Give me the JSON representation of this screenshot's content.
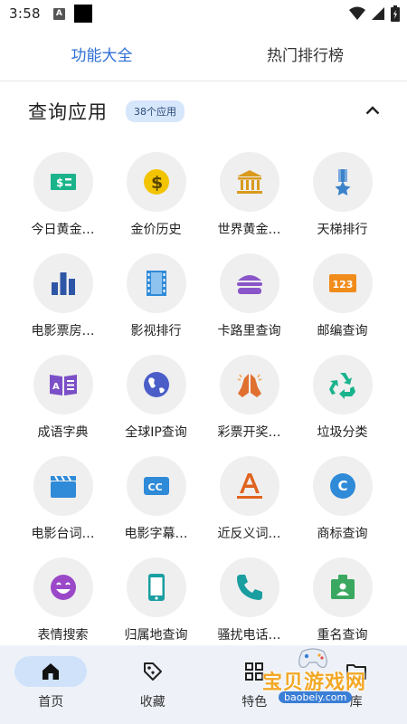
{
  "status_bar": {
    "time": "3:58",
    "a_badge": "A"
  },
  "tabs": [
    {
      "label": "功能大全",
      "active": true
    },
    {
      "label": "热门排行榜",
      "active": false
    }
  ],
  "section": {
    "title": "查询应用",
    "badge": "38个应用"
  },
  "apps": [
    {
      "label": "今日黄金…",
      "icon": "money-icon",
      "color": "#1bb38a"
    },
    {
      "label": "金价历史",
      "icon": "dollar-coin-icon",
      "color": "#f2c400"
    },
    {
      "label": "世界黄金…",
      "icon": "bank-icon",
      "color": "#d99a1e"
    },
    {
      "label": "天梯排行",
      "icon": "medal-icon",
      "color": "#3b82c9"
    },
    {
      "label": "电影票房…",
      "icon": "bar-chart-icon",
      "color": "#2e56a6"
    },
    {
      "label": "影视排行",
      "icon": "film-icon",
      "color": "#2f8ad8"
    },
    {
      "label": "卡路里查询",
      "icon": "burger-icon",
      "color": "#8a55c8"
    },
    {
      "label": "邮编查询",
      "icon": "numbers-icon",
      "color": "#f08c1c"
    },
    {
      "label": "成语字典",
      "icon": "dictionary-icon",
      "color": "#7b4fc7"
    },
    {
      "label": "全球IP查询",
      "icon": "globe-icon",
      "color": "#4b5ec8"
    },
    {
      "label": "彩票开奖…",
      "icon": "praying-hands-icon",
      "color": "#e07030"
    },
    {
      "label": "垃圾分类",
      "icon": "recycle-icon",
      "color": "#19b38c"
    },
    {
      "label": "电影台词…",
      "icon": "clapperboard-icon",
      "color": "#2f8ad8"
    },
    {
      "label": "电影字幕…",
      "icon": "closed-caption-icon",
      "color": "#2f8ad8"
    },
    {
      "label": "近反义词…",
      "icon": "letter-a-icon",
      "color": "#e0641e"
    },
    {
      "label": "商标查询",
      "icon": "copyright-icon",
      "color": "#2f8ad8"
    },
    {
      "label": "表情搜索",
      "icon": "smiley-icon",
      "color": "#9a48c8"
    },
    {
      "label": "归属地查询",
      "icon": "phone-device-icon",
      "color": "#1a9ea0"
    },
    {
      "label": "骚扰电话…",
      "icon": "phone-handset-icon",
      "color": "#1a9ea0"
    },
    {
      "label": "重名查询",
      "icon": "id-badge-icon",
      "color": "#3aa860"
    }
  ],
  "bottom_nav": [
    {
      "label": "首页",
      "icon": "home-icon",
      "active": true
    },
    {
      "label": "收藏",
      "icon": "tag-icon",
      "active": false
    },
    {
      "label": "特色",
      "icon": "grid-icon",
      "active": false
    },
    {
      "label": "库",
      "icon": "folder-icon",
      "active": false
    }
  ],
  "watermark": {
    "text": "宝贝游戏网",
    "url": "baobeiy.com"
  }
}
